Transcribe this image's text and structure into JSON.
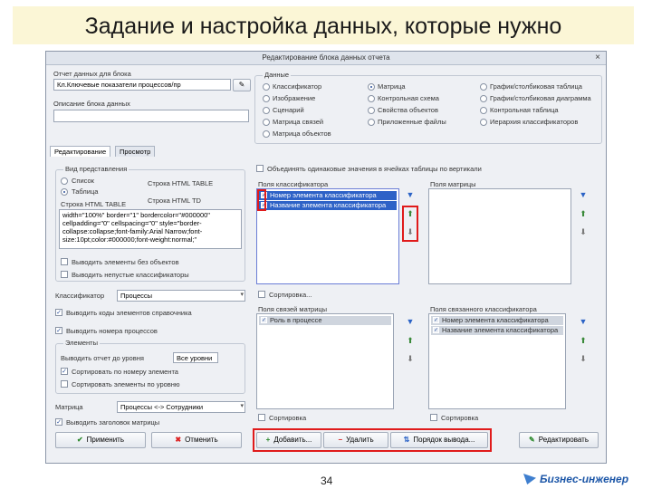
{
  "slide": {
    "title": "Задание и настройка данных, которые нужно",
    "page_number": "34",
    "brand": "Бизнес-инженер"
  },
  "dialog": {
    "title": "Редактирование блока данных отчета",
    "close": "×",
    "report_label": "Отчет данных для блока",
    "report_value": "Кл.Ключевые показатели процессов/пр",
    "description_label": "Описание блока данных",
    "description_value": "",
    "data_group_label": "Данные",
    "radios": [
      {
        "label": "Классификатор",
        "on": false
      },
      {
        "label": "Матрица",
        "on": true
      },
      {
        "label": "График/столбиковая таблица",
        "on": false
      },
      {
        "label": "Изображение",
        "on": false
      },
      {
        "label": "Контрольная схема",
        "on": false
      },
      {
        "label": "График/столбиковая диаграмма",
        "on": false
      },
      {
        "label": "Сценарий",
        "on": false
      },
      {
        "label": "Свойства объектов",
        "on": false
      },
      {
        "label": "Контрольная таблица",
        "on": false
      },
      {
        "label": "Матрица связей",
        "on": false
      },
      {
        "label": "Приложенные файлы",
        "on": false
      },
      {
        "label": "Иерархия классификаторов",
        "on": false
      },
      {
        "label": "Матрица объектов",
        "on": false
      }
    ],
    "tabs": [
      "Редактирование",
      "Просмотр"
    ],
    "combine_label": "Объединять одинаковые значения в ячейках таблицы по вертикали",
    "layout_group_label": "Вид представления",
    "layout_list": "Список",
    "layout_table": "Таблица",
    "row_html_header": "Строка HTML TABLE",
    "row_html_second": "Строка HTML TD",
    "row_html_label": "Строка HTML TABLE",
    "html_text": "width=\"100%\" border=\"1\" bordercolor=\"#000000\" cellpadding=\"0\" cellspacing=\"0\" style=\"border-collapse:collapse;font-family:Arial Narrow;font-size:10pt;color:#000000;font-weight:normal;\"",
    "check_empty": "Выводить элементы без объектов",
    "check_hidden": "Выводить непустые классификаторы",
    "classifier_label": "Классификатор",
    "classifier_value": "Процессы",
    "check_codes": "Выводить коды элементов справочника",
    "check_numbers": "Выводить номера процессов",
    "element_group_label": "Элементы",
    "depth_label": "Выводить отчет до уровня",
    "depth_value": "Все уровни",
    "check_sort": "Сортировать по номеру элемента",
    "check_sort_level": "Сортировать элементы по уровню",
    "matrix_label": "Матрица",
    "matrix_value": "Процессы <-> Сотрудники",
    "check_header": "Выводить заголовок матрицы",
    "class_fields_label": "Поля классификатора",
    "class_fields": [
      {
        "text": "Номер элемента классификатора",
        "checked": true
      },
      {
        "text": "Название элемента классификатора",
        "checked": true
      }
    ],
    "matrix_fields_label": "Поля матрицы",
    "sort_label": "Сортировка...",
    "linked_matrix_label": "Поля связей матрицы",
    "linked_matrix_fields": [
      {
        "text": "Роль в процессе",
        "checked": true
      }
    ],
    "linked_class_label": "Поля связанного классификатора",
    "linked_class_fields": [
      {
        "text": "Номер элемента классификатора",
        "checked": true
      },
      {
        "text": "Название элемента классификатора",
        "checked": true
      }
    ],
    "sort_label_2": "Сортировка",
    "sort_label_3": "Сортировка",
    "ok_button": "Применить",
    "cancel_button": "Отменить",
    "add_button": "Добавить...",
    "delete_button": "Удалить",
    "order_button": "Порядок вывода...",
    "edit_button": "Редактировать"
  }
}
